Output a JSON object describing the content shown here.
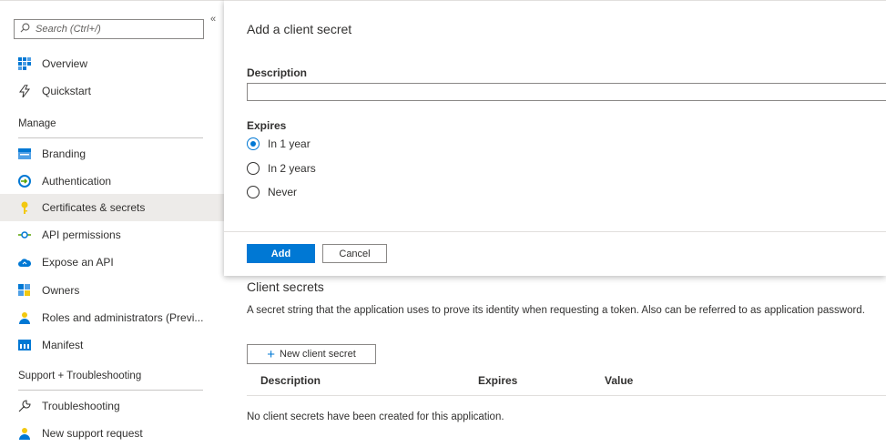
{
  "sidebar": {
    "search_placeholder": "Search (Ctrl+/)",
    "collapse_glyph": "«",
    "top_items": [
      {
        "label": "Overview",
        "icon": "grid-icon"
      },
      {
        "label": "Quickstart",
        "icon": "lightning-icon"
      }
    ],
    "manage_heading": "Manage",
    "manage_items": [
      {
        "label": "Branding",
        "icon": "branding-icon"
      },
      {
        "label": "Authentication",
        "icon": "authentication-icon"
      },
      {
        "label": "Certificates & secrets",
        "icon": "key-icon",
        "active": true
      },
      {
        "label": "API permissions",
        "icon": "api-permissions-icon"
      },
      {
        "label": "Expose an API",
        "icon": "cloud-icon"
      },
      {
        "label": "Owners",
        "icon": "owners-icon"
      },
      {
        "label": "Roles and administrators (Previ...",
        "icon": "person-icon"
      },
      {
        "label": "Manifest",
        "icon": "manifest-icon"
      }
    ],
    "support_heading": "Support + Troubleshooting",
    "support_items": [
      {
        "label": "Troubleshooting",
        "icon": "wrench-icon"
      },
      {
        "label": "New support request",
        "icon": "support-person-icon"
      }
    ]
  },
  "panel": {
    "title": "Add a client secret",
    "description_label": "Description",
    "description_value": "",
    "expires_label": "Expires",
    "options": [
      {
        "label": "In 1 year",
        "selected": true
      },
      {
        "label": "In 2 years",
        "selected": false
      },
      {
        "label": "Never",
        "selected": false
      }
    ],
    "add_label": "Add",
    "cancel_label": "Cancel"
  },
  "main": {
    "title": "Client secrets",
    "description": "A secret string that the application uses to prove its identity when requesting a token. Also can be referred to as application password.",
    "new_button_label": "New client secret",
    "columns": [
      "Description",
      "Expires",
      "Value"
    ],
    "empty_message": "No client secrets have been created for this application."
  },
  "colors": {
    "accent": "#0078d4",
    "active_bg": "#edebe9",
    "text": "#323130"
  }
}
